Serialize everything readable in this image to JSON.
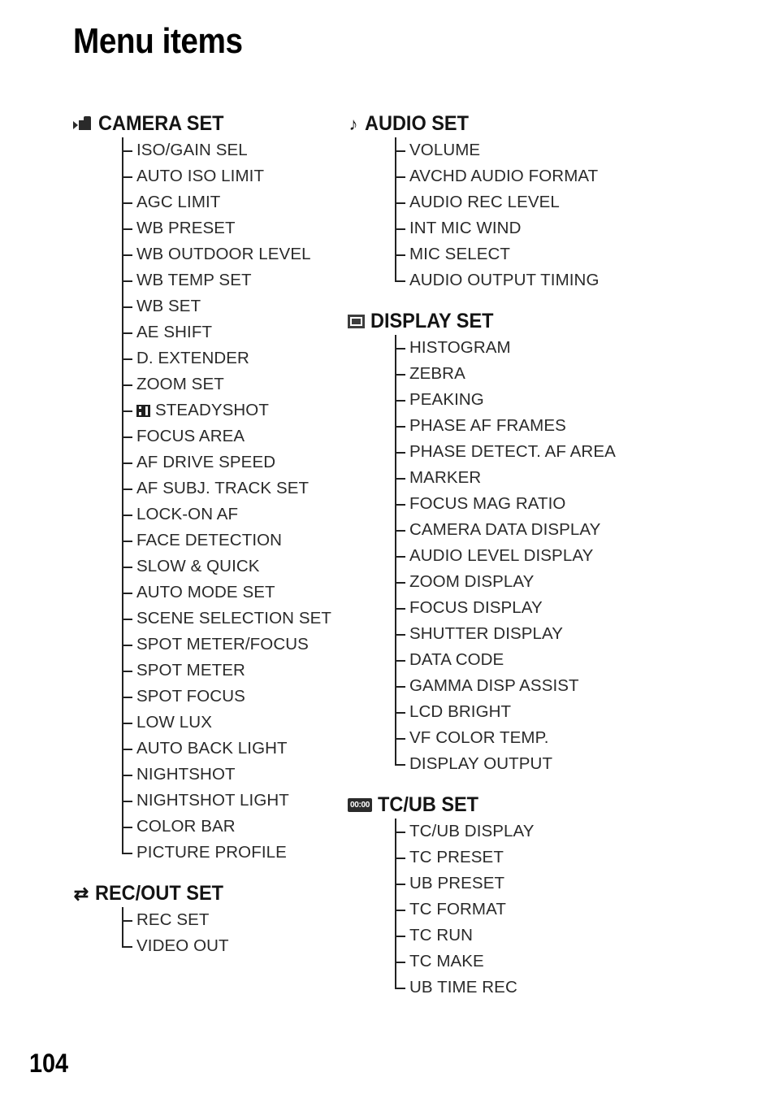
{
  "page": {
    "title": "Menu items",
    "number": "104"
  },
  "columns": {
    "left": [
      {
        "icon": "camcorder-icon",
        "title": "CAMERA SET",
        "items": [
          {
            "label": "ISO/GAIN SEL"
          },
          {
            "label": "AUTO ISO LIMIT"
          },
          {
            "label": "AGC LIMIT"
          },
          {
            "label": "WB PRESET"
          },
          {
            "label": "WB OUTDOOR LEVEL"
          },
          {
            "label": "WB TEMP SET"
          },
          {
            "label": "WB SET"
          },
          {
            "label": "AE SHIFT"
          },
          {
            "label": "D. EXTENDER"
          },
          {
            "label": "ZOOM SET"
          },
          {
            "label": "STEADYSHOT",
            "icon": "film-strip-icon"
          },
          {
            "label": "FOCUS AREA"
          },
          {
            "label": "AF DRIVE SPEED"
          },
          {
            "label": "AF SUBJ. TRACK SET"
          },
          {
            "label": "LOCK-ON AF"
          },
          {
            "label": "FACE DETECTION"
          },
          {
            "label": "SLOW & QUICK"
          },
          {
            "label": "AUTO MODE SET"
          },
          {
            "label": "SCENE SELECTION SET"
          },
          {
            "label": "SPOT METER/FOCUS"
          },
          {
            "label": "SPOT METER"
          },
          {
            "label": "SPOT FOCUS"
          },
          {
            "label": "LOW LUX"
          },
          {
            "label": "AUTO BACK LIGHT"
          },
          {
            "label": "NIGHTSHOT"
          },
          {
            "label": "NIGHTSHOT LIGHT"
          },
          {
            "label": "COLOR BAR"
          },
          {
            "label": "PICTURE PROFILE"
          }
        ]
      },
      {
        "icon": "swap-arrows-icon",
        "title": "REC/OUT SET",
        "items": [
          {
            "label": "REC SET"
          },
          {
            "label": "VIDEO OUT"
          }
        ]
      }
    ],
    "right": [
      {
        "icon": "music-note-icon",
        "title": "AUDIO SET",
        "items": [
          {
            "label": "VOLUME"
          },
          {
            "label": "AVCHD AUDIO FORMAT"
          },
          {
            "label": "AUDIO REC LEVEL"
          },
          {
            "label": "INT MIC WIND"
          },
          {
            "label": "MIC SELECT"
          },
          {
            "label": "AUDIO OUTPUT TIMING"
          }
        ]
      },
      {
        "icon": "monitor-icon",
        "title": "DISPLAY SET",
        "items": [
          {
            "label": "HISTOGRAM"
          },
          {
            "label": "ZEBRA"
          },
          {
            "label": "PEAKING"
          },
          {
            "label": "PHASE AF FRAMES"
          },
          {
            "label": "PHASE DETECT. AF AREA"
          },
          {
            "label": "MARKER"
          },
          {
            "label": "FOCUS MAG RATIO"
          },
          {
            "label": "CAMERA DATA DISPLAY"
          },
          {
            "label": "AUDIO LEVEL DISPLAY"
          },
          {
            "label": "ZOOM DISPLAY"
          },
          {
            "label": "FOCUS DISPLAY"
          },
          {
            "label": "SHUTTER DISPLAY"
          },
          {
            "label": "DATA CODE"
          },
          {
            "label": "GAMMA DISP ASSIST"
          },
          {
            "label": "LCD BRIGHT"
          },
          {
            "label": "VF COLOR TEMP."
          },
          {
            "label": "DISPLAY OUTPUT"
          }
        ]
      },
      {
        "icon": "timecode-badge-icon",
        "title": "TC/UB SET",
        "icon_text": "00:00",
        "items": [
          {
            "label": "TC/UB DISPLAY"
          },
          {
            "label": "TC PRESET"
          },
          {
            "label": "UB PRESET"
          },
          {
            "label": "TC FORMAT"
          },
          {
            "label": "TC RUN"
          },
          {
            "label": "TC MAKE"
          },
          {
            "label": "UB TIME REC"
          }
        ]
      }
    ]
  },
  "icons": {
    "music_note_glyph": "♪",
    "swap_arrows_glyph": "⇄"
  }
}
